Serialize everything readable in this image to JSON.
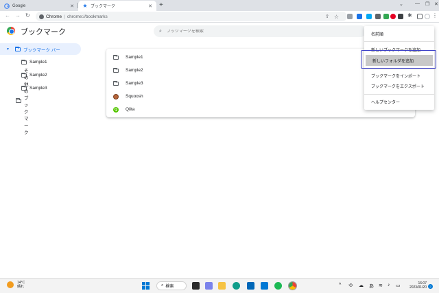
{
  "browser": {
    "tabs": [
      {
        "title": "Google",
        "active": false
      },
      {
        "title": "ブックマーク",
        "active": true
      }
    ],
    "new_tab_icon": "plus-icon",
    "address": {
      "site": "Chrome",
      "url": "chrome://bookmarks"
    },
    "window_controls": [
      "minimize",
      "maximize",
      "close"
    ]
  },
  "bookmarks_page": {
    "title": "ブックマーク",
    "search_placeholder": "ブックマークを検索"
  },
  "sidebar": {
    "items": [
      {
        "label": "ブックマーク バー",
        "active": true,
        "expanded": true
      },
      {
        "label": "Sample1",
        "active": false
      },
      {
        "label": "Sample2",
        "active": false
      },
      {
        "label": "Sample3",
        "active": false
      },
      {
        "label": "その他のブックマーク",
        "active": false
      }
    ]
  },
  "list": {
    "rows": [
      {
        "label": "Sample1",
        "icon": "folder-icon"
      },
      {
        "label": "Sample2",
        "icon": "folder-icon"
      },
      {
        "label": "Sample3",
        "icon": "folder-icon"
      },
      {
        "label": "Squoosh",
        "icon": "squoosh-favicon"
      },
      {
        "label": "Qiita",
        "icon": "qiita-favicon"
      }
    ]
  },
  "menu": {
    "items": [
      {
        "label": "名前順",
        "highlighted": false
      },
      {
        "label": "新しいブックマークを追加",
        "highlighted": false
      },
      {
        "label": "新しいフォルダを追加",
        "highlighted": true
      },
      {
        "label": "ブックマークをインポート",
        "highlighted": false
      },
      {
        "label": "ブックマークをエクスポート",
        "highlighted": false
      },
      {
        "label": "ヘルプセンター",
        "highlighted": false
      }
    ]
  },
  "taskbar": {
    "weather": {
      "temp": "14°C",
      "condition": "晴れ"
    },
    "search_label": "検索",
    "ime": "あ",
    "clock": {
      "time": "16:07",
      "date": "2023/01/20"
    },
    "notifications": "2"
  },
  "colors": {
    "accent": "#1a73e8",
    "focus_ring": "#3b3fc8",
    "menu_highlight": "#c8c8c8"
  }
}
